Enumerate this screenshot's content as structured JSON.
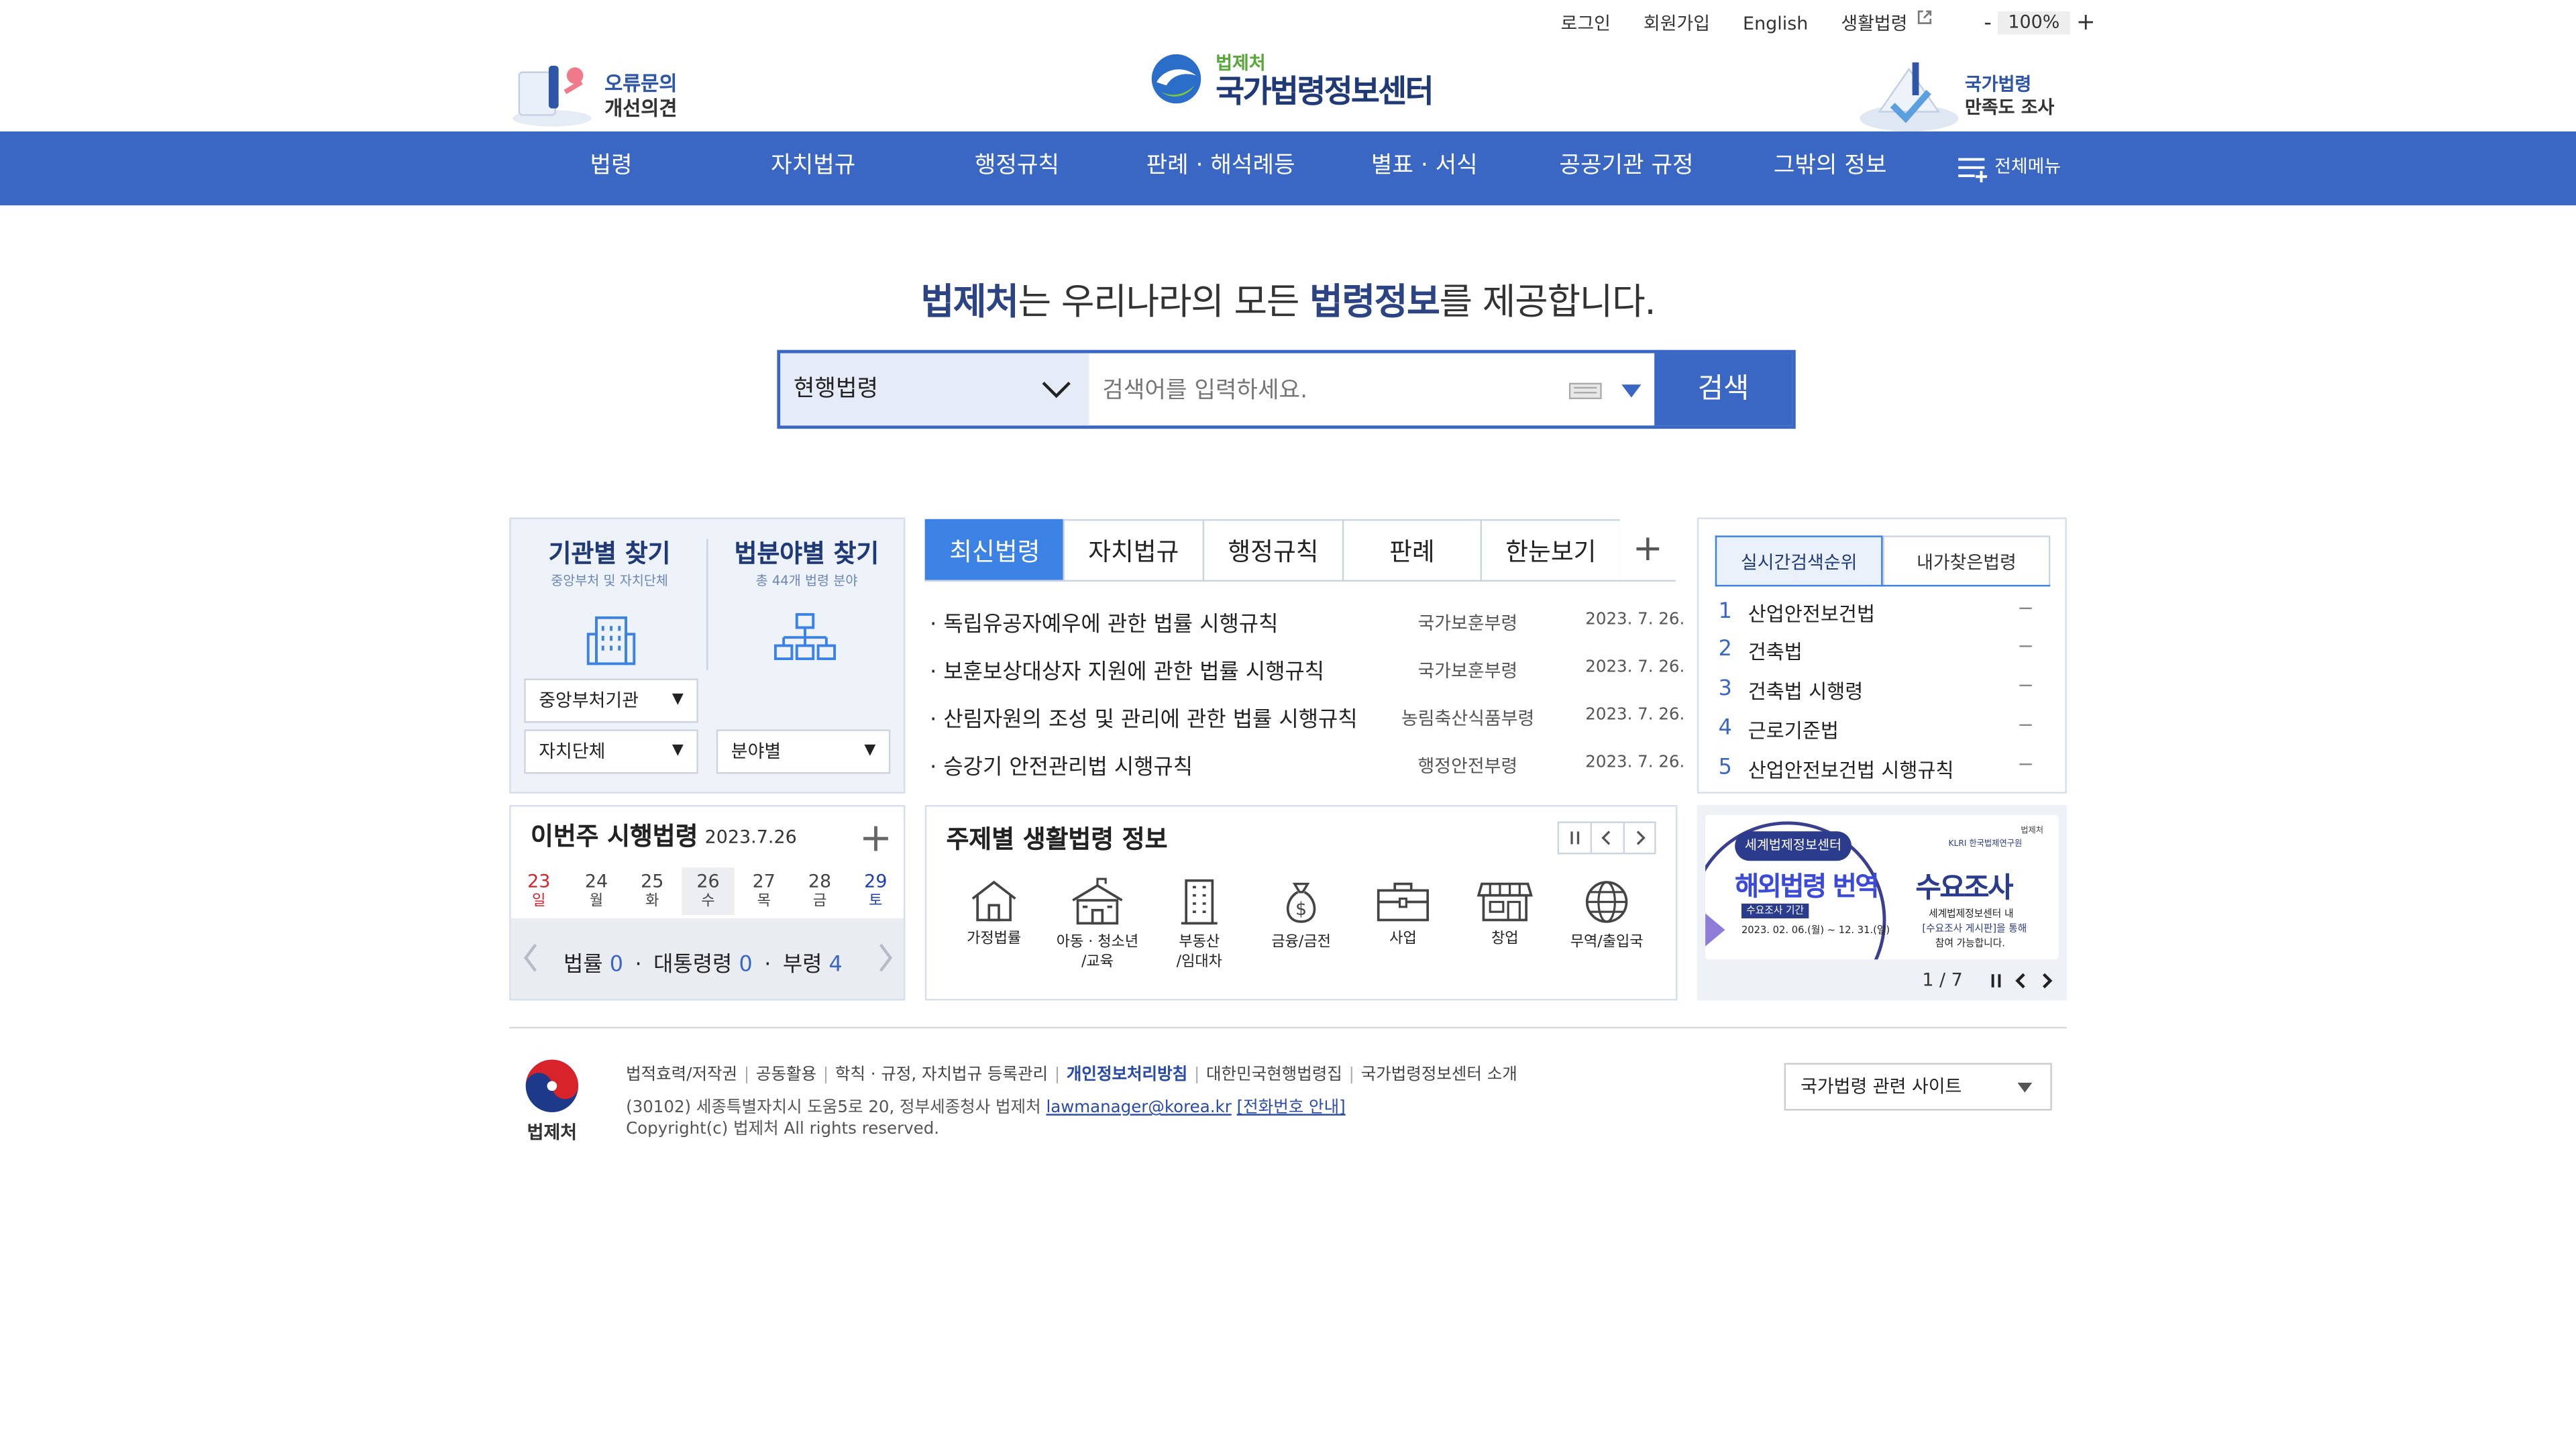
{
  "utility": {
    "login": "로그인",
    "join": "회원가입",
    "english": "English",
    "life_law": "생활법령",
    "zoom_minus": "-",
    "zoom_value": "100%",
    "zoom_plus": "+"
  },
  "header": {
    "left_promo_line1": "오류문의",
    "left_promo_line2": "개선의견",
    "logo_sub": "법제처",
    "logo_main": "국가법령정보센터",
    "right_promo_line1": "국가법령",
    "right_promo_line2": "만족도 조사"
  },
  "nav": {
    "items": [
      "법령",
      "자치법규",
      "행정규칙",
      "판례 · 해석례등",
      "별표 · 서식",
      "공공기관 규정",
      "그밖의 정보"
    ],
    "all_menu": "전체메뉴"
  },
  "search": {
    "headline_b1": "법제처",
    "headline_t1": "는 우리나라의 모든 ",
    "headline_b2": "법령정보",
    "headline_t2": "를 제공합니다.",
    "category": "현행법령",
    "placeholder": "검색어를 입력하세요.",
    "button": "검색"
  },
  "find": {
    "org_title": "기관별 찾기",
    "org_sub": "중앙부처 및 자치단체",
    "field_title": "법분야별 찾기",
    "field_sub": "총 44개 법령 분야",
    "dd_central": "중앙부처기관",
    "dd_local": "자치단체",
    "dd_field": "분야별"
  },
  "tabs": {
    "items": [
      "최신법령",
      "자치법규",
      "행정규칙",
      "판례",
      "한눈보기"
    ],
    "plus": "+"
  },
  "latest_laws": [
    {
      "title": "· 독립유공자예우에 관한 법률 시행규칙",
      "agency": "국가보훈부령",
      "date": "2023. 7. 26."
    },
    {
      "title": "· 보훈보상대상자 지원에 관한 법률 시행규칙",
      "agency": "국가보훈부령",
      "date": "2023. 7. 26."
    },
    {
      "title": "· 산림자원의 조성 및 관리에 관한 법률 시행규칙",
      "agency": "농림축산식품부령",
      "date": "2023. 7. 26."
    },
    {
      "title": "· 승강기 안전관리법 시행규칙",
      "agency": "행정안전부령",
      "date": "2023. 7. 26."
    }
  ],
  "ranking": {
    "tab_realtime": "실시간검색순위",
    "tab_mine": "내가찾은법령",
    "items": [
      {
        "rank": "1",
        "label": "산업안전보건법",
        "change": "−"
      },
      {
        "rank": "2",
        "label": "건축법",
        "change": "−"
      },
      {
        "rank": "3",
        "label": "건축법 시행령",
        "change": "−"
      },
      {
        "rank": "4",
        "label": "근로기준법",
        "change": "−"
      },
      {
        "rank": "5",
        "label": "산업안전보건법 시행규칙",
        "change": "−"
      }
    ]
  },
  "week": {
    "title": "이번주 시행법령",
    "date": "2023.7.26",
    "plus": "+",
    "days": [
      {
        "num": "23",
        "wd": "일",
        "color": "#d8232a"
      },
      {
        "num": "24",
        "wd": "월",
        "color": "#444444"
      },
      {
        "num": "25",
        "wd": "화",
        "color": "#444444"
      },
      {
        "num": "26",
        "wd": "수",
        "color": "#444444"
      },
      {
        "num": "27",
        "wd": "목",
        "color": "#444444"
      },
      {
        "num": "28",
        "wd": "금",
        "color": "#444444"
      },
      {
        "num": "29",
        "wd": "토",
        "color": "#1f3fb8"
      }
    ],
    "law_label": "법률",
    "law_count": "0",
    "decree_label": "대통령령",
    "decree_count": "0",
    "ordinance_label": "부령",
    "ordinance_count": "4"
  },
  "themes": {
    "title": "주제별 생활법령 정보",
    "items": [
      {
        "line1": "가정법률",
        "line2": ""
      },
      {
        "line1": "아동 · 청소년",
        "line2": "/교육"
      },
      {
        "line1": "부동산",
        "line2": "/임대차"
      },
      {
        "line1": "금융/금전",
        "line2": ""
      },
      {
        "line1": "사업",
        "line2": ""
      },
      {
        "line1": "창업",
        "line2": ""
      },
      {
        "line1": "무역/출입국",
        "line2": ""
      }
    ]
  },
  "banner": {
    "org_small": "세계법제정보센터",
    "big1": "해외법령 번역",
    "big2": "수요조사",
    "period_label": "수요조사 기간",
    "period": "2023. 02. 06.(월) ~ 12. 31.(일)",
    "note1": "세계법제정보센터 내",
    "note2": "[수요조사 게시판]을 통해",
    "note3": "참여 가능합니다.",
    "brand": "KLRI 한국법제연구원",
    "brand_small": "법제처",
    "page": "1 / 7"
  },
  "footer": {
    "links": [
      "법적효력/저작권",
      "공동활용",
      "학칙 · 규정, 자치법규 등록관리",
      "개인정보처리방침",
      "대한민국현행법령집",
      "국가법령정보센터 소개"
    ],
    "address": "(30102) 세종특별자치시 도움5로 20, 정부세종청사 법제처",
    "email": "lawmanager@korea.kr",
    "phone_link": "[전화번호 안내]",
    "copyright": "Copyright(c) 법제처 All rights reserved.",
    "logo_text": "법제처",
    "related_sites": "국가법령 관련 사이트"
  },
  "colors": {
    "nav_blue": "#3b67c4",
    "tab_active": "#3b82e4",
    "navy": "#1f3a76",
    "red": "#d8232a"
  }
}
